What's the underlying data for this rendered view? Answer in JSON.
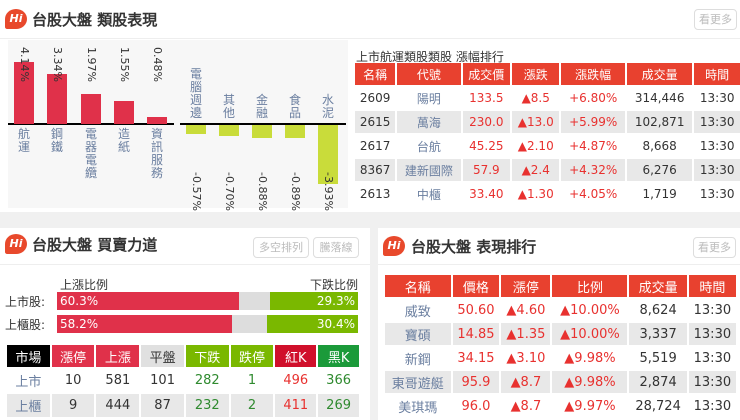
{
  "top": {
    "title": "台股大盤 類股表現",
    "more": "看更多",
    "logo": "Hi"
  },
  "chart_data": {
    "type": "bar",
    "categories": [
      "航運",
      "鋼鐵",
      "電器電纜",
      "造紙",
      "資訊服務",
      "電腦週邊",
      "其他",
      "金融",
      "食品",
      "水泥"
    ],
    "values": [
      4.14,
      3.34,
      1.97,
      1.55,
      0.48,
      -0.57,
      -0.7,
      -0.88,
      -0.89,
      -3.93
    ],
    "labels": [
      "4.14%",
      "3.34%",
      "1.97%",
      "1.55%",
      "0.48%",
      "-0.57%",
      "-0.70%",
      "-0.88%",
      "-0.89%",
      "-3.93%"
    ],
    "colors": {
      "up": "#e0314a",
      "down": "#c9dc3a"
    }
  },
  "sector": {
    "title": "上市航運類股類股 漲幅排行",
    "headers": [
      "名稱",
      "代號",
      "成交價",
      "漲跌",
      "漲跌幅",
      "成交量",
      "時間"
    ],
    "rows": [
      [
        "2609",
        "陽明",
        "133.5",
        "▲8.5",
        "+6.80%",
        "314,446",
        "13:30"
      ],
      [
        "2615",
        "萬海",
        "230.0",
        "▲13.0",
        "+5.99%",
        "102,871",
        "13:30"
      ],
      [
        "2617",
        "台航",
        "45.25",
        "▲2.10",
        "+4.87%",
        "8,668",
        "13:30"
      ],
      [
        "8367",
        "建新國際",
        "57.9",
        "▲2.4",
        "+4.32%",
        "6,276",
        "13:30"
      ],
      [
        "2613",
        "中櫃",
        "33.40",
        "▲1.30",
        "+4.05%",
        "1,719",
        "13:30"
      ]
    ]
  },
  "force": {
    "title": "台股大盤 買賣力道",
    "btn1": "多空排列",
    "btn2": "騰落線",
    "up_label": "上漲比例",
    "down_label": "下跌比例",
    "ratios": [
      {
        "label": "上市股:",
        "up": "60.3%",
        "down": "29.3%",
        "upv": 60.3,
        "downv": 29.3
      },
      {
        "label": "上櫃股:",
        "up": "58.2%",
        "down": "30.4%",
        "upv": 58.2,
        "downv": 30.4
      }
    ],
    "headers": [
      "市場",
      "漲停",
      "上漲",
      "平盤",
      "下跌",
      "跌停",
      "紅K",
      "黑K"
    ],
    "rows": [
      [
        "上市",
        "10",
        "581",
        "101",
        "282",
        "1",
        "496",
        "366"
      ],
      [
        "上櫃",
        "9",
        "444",
        "87",
        "232",
        "2",
        "411",
        "269"
      ]
    ]
  },
  "rank": {
    "title": "台股大盤 表現排行",
    "more": "看更多",
    "headers": [
      "名稱",
      "價格",
      "漲停",
      "比例",
      "成交量",
      "時間"
    ],
    "rows": [
      [
        "威致",
        "50.60",
        "▲4.60",
        "▲10.00%",
        "8,624",
        "13:30"
      ],
      [
        "寶碩",
        "14.85",
        "▲1.35",
        "▲10.00%",
        "3,337",
        "13:30"
      ],
      [
        "新鋼",
        "34.15",
        "▲3.10",
        "▲9.98%",
        "5,519",
        "13:30"
      ],
      [
        "東哥遊艇",
        "95.9",
        "▲8.7",
        "▲9.98%",
        "2,874",
        "13:30"
      ],
      [
        "美琪瑪",
        "96.0",
        "▲8.7",
        "▲9.97%",
        "28,724",
        "13:30"
      ]
    ]
  }
}
